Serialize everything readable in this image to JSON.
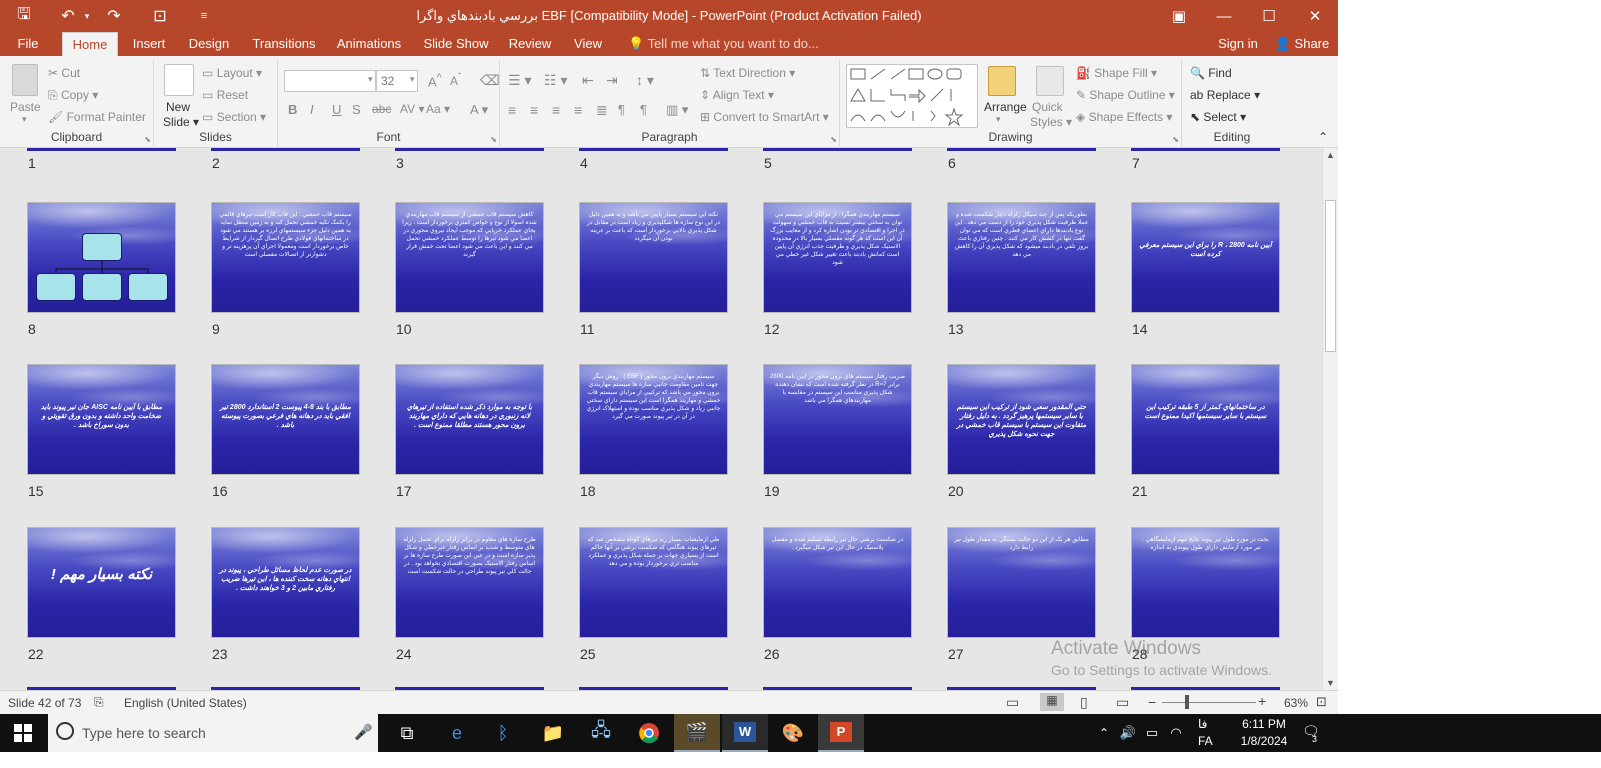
{
  "titlebar": {
    "title": "بررسي بادبندهاي واگرا  EBF [Compatibility Mode] - PowerPoint (Product Activation Failed)",
    "save_glyph": "🖫",
    "undo_glyph": "↶",
    "redo_glyph": "↷",
    "present_glyph": "⊡",
    "customize_glyph": "≡",
    "restore_glyph": "🗗",
    "minimize_glyph": "—",
    "maximize_glyph": "☐",
    "close_glyph": "✕",
    "ribbon_options_glyph": "▣"
  },
  "menu": {
    "tabs": [
      "File",
      "Home",
      "Insert",
      "Design",
      "Transitions",
      "Animations",
      "Slide Show",
      "Review",
      "View"
    ],
    "active_tab": "Home",
    "tell_me": "Tell me what you want to do...",
    "sign_in": "Sign in",
    "share": "Share"
  },
  "ribbon": {
    "clipboard": {
      "paste": "Paste",
      "cut": "Cut",
      "copy": "Copy",
      "format_painter": "Format Painter",
      "label": "Clipboard"
    },
    "slides": {
      "new_slide": "New",
      "new_slide_2": "Slide",
      "layout": "Layout",
      "reset": "Reset",
      "section": "Section",
      "label": "Slides"
    },
    "font": {
      "font_name": "",
      "font_size": "32",
      "label": "Font"
    },
    "paragraph": {
      "text_direction": "Text Direction",
      "align_text": "Align Text",
      "convert_smartart": "Convert to SmartArt",
      "label": "Paragraph"
    },
    "drawing": {
      "arrange": "Arrange",
      "quick_styles": "Quick",
      "quick_styles_2": "Styles",
      "shape_fill": "Shape Fill",
      "shape_outline": "Shape Outline",
      "shape_effects": "Shape Effects",
      "label": "Drawing"
    },
    "editing": {
      "find": "Find",
      "replace": "Replace",
      "select": "Select",
      "label": "Editing"
    }
  },
  "slides": [
    {
      "num": "1"
    },
    {
      "num": "2"
    },
    {
      "num": "3"
    },
    {
      "num": "4"
    },
    {
      "num": "5"
    },
    {
      "num": "6"
    },
    {
      "num": "7"
    },
    {
      "num": "8",
      "text": ""
    },
    {
      "num": "9",
      "text": "سيستم قاب خمشي : اين قاب کار است تيرهاي قائمي را بکمک تکيه خمشي تحمل کند و به زمين منتقل نمايد به همين دليل جزء سيستمهاي لرزه بر هستند مي شود در ساختمانهاي فولادي طرح اتصال گيردار از شرايط خاص برخوردار است ومعمولا اجراي آن پرهزينه تر و دشوارتر از اتصالات مفصلي است"
    },
    {
      "num": "10",
      "text": "کاهش سيستم قاب خمشي از سيستم قاب مهاربندي شده اصولا از نوع و خواص کمتري برخوردار است . زيرا بجاي عملکرد خرپايي که موجب ايجاد نيروي محوري در اعضا مي شود تيرها را توسط عملکرد خمشي تحمل مي کنند و اين باعث مي شود اعضا تحت خمش قرار گيرند"
    },
    {
      "num": "11",
      "text": "نکته اين سيستم بسيار پايين مي باشد و به همين دليل در اين نوع سازه ها شکلپذيري و زياد است در مقابل در شکل پذيري بالايي برخوردار است که باعث بر عرينه بودن آن ميگردد"
    },
    {
      "num": "12",
      "text": "سيستم مهاربندي همگرا : از مزاياي اين سيستم مي توان به سختي بيشتر نسبت به قاب خمشي و سهولت در اجرا و اقتصادي تر بودن اشاره کرد و از معايب بزرگ آن اين است که هر گونه مفصلي بسيار بالا در محدوده الاستيک شکل پذيري و ظرفيت جذب انرژي آن پايين است کمانش بادبند باعث تغيير شکل غير خطي مي شود"
    },
    {
      "num": "13",
      "text": "بطوريکه پس از چند سيکل زلزله دچار شکست شده و عملا ظرفيت شکل پذيري خود را از دست مي دهد . اين نوع بادبندها داراي اعضاي قطري است که مي توان گفت تنها در کشش کار مي کنند . چنين رفتاري باعث بروز تلفي در بادبند ميشود که شکل پذيري آن را کاهش مي دهد"
    },
    {
      "num": "14",
      "text": "آيين نامه 2800 ، R را براي اين سيستم معرفي کرده است"
    },
    {
      "num": "15",
      "text": "مطابق با آيين نامه AISC جان تير پيوند بايد ضخامت واحد داشته و بدون ورق تقويتي و بدون سوراخ باشد ."
    },
    {
      "num": "16",
      "text": "مطابق با بند 8-4 پيوست 2 استاندارد 2800 تير افقي بايد در دهانه هاي فرعي بصورت پيوسته باشد ."
    },
    {
      "num": "17",
      "text": "با توجه به موارد ذکر شده استفاده از تيرهاي لانه زنبوري در دهانه هايي که داراي مهاربند برون محور هستند مطلقا ممنوع است ."
    },
    {
      "num": "18",
      "text": "سيستم مهاربندي برون محور ( EBF ) : روش ديگر جهت تامين مقاومت جانبي سازه ها سيستم مهاربندي برون محور مي باشد که ترکيبي از مزاياي سيستم قاب خمشي و مهاربند همگرا است اين سيستم داراي سختي جانبي زياد و شکل پذيري مناسب بوده و استهلاک انرژي در آن در تير پيوند صورت مي گيرد"
    },
    {
      "num": "19",
      "text": "ضريب رفتار سيستم هاي برون محور در آيين نامه 2800 برابر R=7 در نظر گرفته شده است که نشان دهنده شکل پذيري مناسب اين سيستم در مقايسه با مهاربندهاي همگرا مي باشد"
    },
    {
      "num": "20",
      "text": "حتي المقدور سعي شود از ترکيب اين سيستم با ساير سيستمها پرهيز گردد . به دليل رفتار متفاوت اين سيستم با سيستم قاب خمشي در جهت نحوه شکل پذيري"
    },
    {
      "num": "21",
      "text": "در ساختمانهاي کمتر از 5 طبقه ترکيب اين سيستم با ساير سيستمها اکيدا ممنوع است"
    },
    {
      "num": "22",
      "text": "نکته بسيار مهم !"
    },
    {
      "num": "23",
      "text": "در صورت عدم لحاظ مسائل طراحي ، پيوند در انتهاي دهانه سخت کننده ها ، اين تيرها ضريب رفتاري مابين 2 و 3 خواهند داشت ."
    },
    {
      "num": "24",
      "text": "طرح سازه هاي مقاوم در برابر زلزله براي تحمل زلزله هاي متوسط و شديد بر اساس رفتار غيرخطي و شکل پذير سازه است و در عين اين صورت طرح سازه ها بر اساس رفتار الاستيک بصورت اقتصادي نخواهد بود . در حالت کلي تير پيوند طراحي در حالت شکست است"
    },
    {
      "num": "25",
      "text": "طي آزمايشات بسيار زيد تيرهاي کوتاه مشخص شد که تيرهاي پيوند هنگامي که شکست برشي بر آنها حاکم است از بسياري جهات بر جملة شکل پذيري و عملکرد مناسب تري برخوردار بوده و مي دهد"
    },
    {
      "num": "26",
      "text": "در شکست برشي حال تير رابطه تسليم شده و مفصل پلاستيک در حال اين تير شکل ميگيرد ."
    },
    {
      "num": "27",
      "text": "مطابق هر يک از اين دو حالت بستگي به مقدار طول تير رابط دارد"
    },
    {
      "num": "28",
      "text": "بحث در مورد طول تير پيوند نتايج مهم آزمايشگاهي : تير مورد آزمايش داراي طول پيوندي به اندازه"
    }
  ],
  "status": {
    "slide_count": "Slide 42 of 73",
    "language": "English (United States)",
    "zoom": "63%",
    "activate1": "Activate Windows",
    "activate2": "Go to Settings to activate Windows."
  },
  "taskbar": {
    "search_placeholder": "Type here to search",
    "time": "6:11 PM",
    "date": "1/8/2024",
    "lang": "FA",
    "lang_fa": "فا",
    "notifications": "3"
  },
  "colors": {
    "accent": "#b7472a",
    "slide_bg": "#2b25a8"
  }
}
